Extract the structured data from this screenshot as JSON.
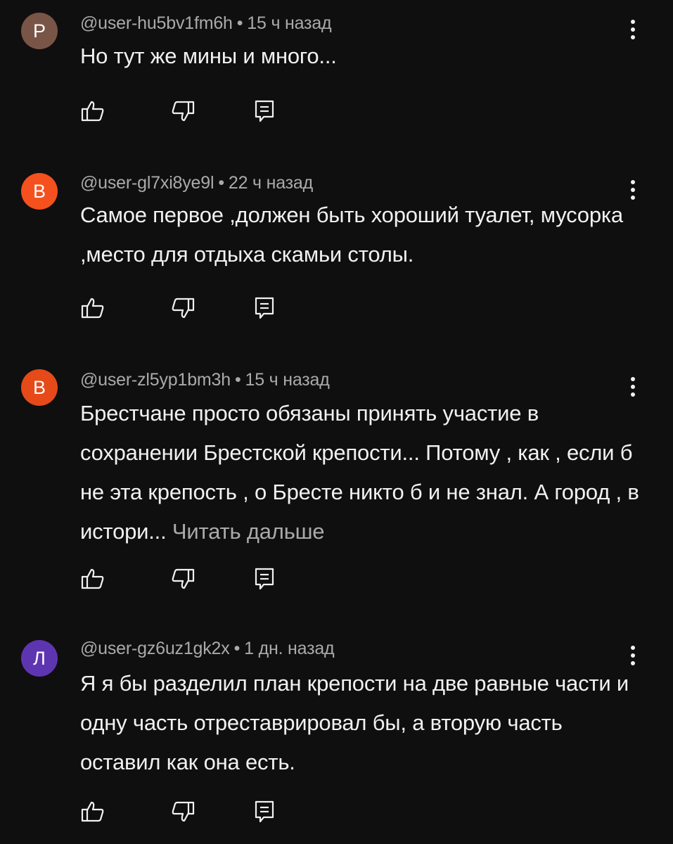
{
  "comments": [
    {
      "avatar_letter": "Р",
      "avatar_color": "#795548",
      "username": "@user-hu5bv1fm6h",
      "separator": "•",
      "time": "15 ч назад",
      "text": "Но тут же мины и много...",
      "read_more": ""
    },
    {
      "avatar_letter": "В",
      "avatar_color": "#f4511e",
      "username": "@user-gl7xi8ye9l",
      "separator": "•",
      "time": "22 ч назад",
      "text": "Самое первое ,должен быть хороший туалет, мусорка ,место для отдыха скамьи столы.",
      "read_more": ""
    },
    {
      "avatar_letter": "В",
      "avatar_color": "#e64a19",
      "username": "@user-zl5yp1bm3h",
      "separator": "•",
      "time": "15 ч назад",
      "text": "Брестчане  просто обязаны принять участие в сохранении Брестской крепости... Потому , как , если б не эта крепость , о Бресте никто б и не знал. А город , в истори... ",
      "read_more": "Читать дальше"
    },
    {
      "avatar_letter": "Л",
      "avatar_color": "#5e35b1",
      "username": "@user-gz6uz1gk2x",
      "separator": "•",
      "time": "1 дн. назад",
      "text": "Я я бы разделил план крепости на две равные части и одну часть отреставрировал бы, а вторую часть оставил как она есть.",
      "read_more": ""
    }
  ],
  "icons": {
    "like": "thumb-up-outline",
    "dislike": "thumb-down-outline",
    "reply": "reply-comment-outline",
    "menu": "more-vertical"
  }
}
